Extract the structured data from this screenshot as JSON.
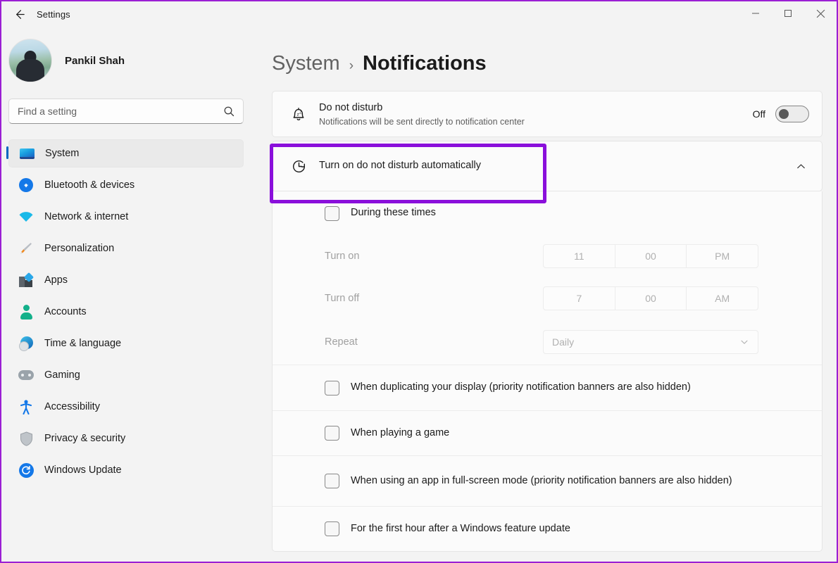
{
  "titlebar": {
    "back_label": "back-arrow",
    "app_title": "Settings",
    "minimize": "–",
    "maximize": "□",
    "close": "✕"
  },
  "sidebar": {
    "profile": {
      "name": "Pankil Shah"
    },
    "search": {
      "placeholder": "Find a setting",
      "value": ""
    },
    "items": [
      {
        "label": "System",
        "icon": "monitor-icon",
        "selected": true
      },
      {
        "label": "Bluetooth & devices",
        "icon": "bluetooth-icon",
        "selected": false
      },
      {
        "label": "Network & internet",
        "icon": "wifi-icon",
        "selected": false
      },
      {
        "label": "Personalization",
        "icon": "paintbrush-icon",
        "selected": false
      },
      {
        "label": "Apps",
        "icon": "apps-icon",
        "selected": false
      },
      {
        "label": "Accounts",
        "icon": "person-icon",
        "selected": false
      },
      {
        "label": "Time & language",
        "icon": "clock-globe-icon",
        "selected": false
      },
      {
        "label": "Gaming",
        "icon": "gamepad-icon",
        "selected": false
      },
      {
        "label": "Accessibility",
        "icon": "accessibility-icon",
        "selected": false
      },
      {
        "label": "Privacy & security",
        "icon": "shield-icon",
        "selected": false
      },
      {
        "label": "Windows Update",
        "icon": "update-icon",
        "selected": false
      }
    ]
  },
  "header": {
    "parent": "System",
    "separator": "›",
    "current": "Notifications"
  },
  "do_not_disturb": {
    "icon": "bell-zzz-icon",
    "title": "Do not disturb",
    "subtitle": "Notifications will be sent directly to notification center",
    "toggle_state_label": "Off",
    "toggle_on": false
  },
  "auto_dnd": {
    "icon": "clock-history-icon",
    "title": "Turn on do not disturb automatically",
    "expanded": true,
    "chevron": "chevron-up-icon",
    "highlight_color": "#8a0fdb",
    "during_times": {
      "label": "During these times",
      "checked": false,
      "turn_on": {
        "label": "Turn on",
        "hour": "11",
        "minute": "00",
        "meridiem": "PM"
      },
      "turn_off": {
        "label": "Turn off",
        "hour": "7",
        "minute": "00",
        "meridiem": "AM"
      },
      "repeat": {
        "label": "Repeat",
        "value": "Daily"
      }
    },
    "conditions": [
      {
        "label": "When duplicating your display (priority notification banners are also hidden)",
        "checked": false
      },
      {
        "label": "When playing a game",
        "checked": false
      },
      {
        "label": "When using an app in full-screen mode (priority notification banners are also hidden)",
        "checked": false
      },
      {
        "label": "For the first hour after a Windows feature update",
        "checked": false
      }
    ]
  },
  "colors": {
    "accent": "#0067c0",
    "highlight": "#8a0fdb",
    "page_bg": "#f3f3f3",
    "card_bg": "#fbfbfb"
  }
}
